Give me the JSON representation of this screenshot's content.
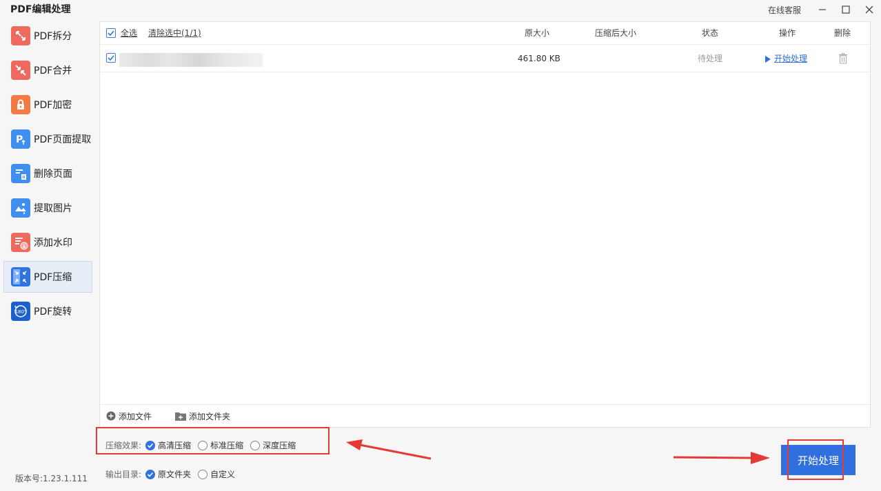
{
  "app": {
    "title": "PDF编辑处理",
    "service": "在线客服",
    "version": "版本号:1.23.1.111"
  },
  "sidebar": {
    "items": [
      {
        "label": "PDF拆分",
        "icon": "split-icon",
        "color": "#ee6a5e"
      },
      {
        "label": "PDF合并",
        "icon": "merge-icon",
        "color": "#ee6a5e"
      },
      {
        "label": "PDF加密",
        "icon": "lock-icon",
        "color": "#f47a45"
      },
      {
        "label": "PDF页面提取",
        "icon": "page-extract-icon",
        "color": "#3f8ef0"
      },
      {
        "label": "删除页面",
        "icon": "delete-page-icon",
        "color": "#3f8ef0"
      },
      {
        "label": "提取图片",
        "icon": "extract-image-icon",
        "color": "#3f8ef0"
      },
      {
        "label": "添加水印",
        "icon": "watermark-icon",
        "color": "#ee6a5e"
      },
      {
        "label": "PDF压缩",
        "icon": "compress-icon",
        "color": "#2f73df",
        "active": true
      },
      {
        "label": "PDF旋转",
        "icon": "rotate-icon",
        "color": "#1d5fcf"
      }
    ]
  },
  "table": {
    "select_all": "全选",
    "clear_selected": "清除选中(1/1)",
    "columns": {
      "original_size": "原大小",
      "compressed_size": "压缩后大小",
      "status": "状态",
      "action": "操作",
      "delete": "删除"
    },
    "rows": [
      {
        "size": "461.80 KB",
        "compressed": "",
        "status": "待处理",
        "action": "开始处理",
        "checked": true
      }
    ]
  },
  "toolbar": {
    "add_file": "添加文件",
    "add_folder": "添加文件夹"
  },
  "options": {
    "compress_label": "压缩效果:",
    "compress_choices": [
      {
        "label": "高清压缩",
        "selected": true
      },
      {
        "label": "标准压缩",
        "selected": false
      },
      {
        "label": "深度压缩",
        "selected": false
      }
    ],
    "output_label": "输出目录:",
    "output_choices": [
      {
        "label": "原文件夹",
        "selected": true
      },
      {
        "label": "自定义",
        "selected": false
      }
    ]
  },
  "start_button": "开始处理",
  "colors": {
    "accent": "#2f6fde",
    "highlight": "#e53935"
  }
}
